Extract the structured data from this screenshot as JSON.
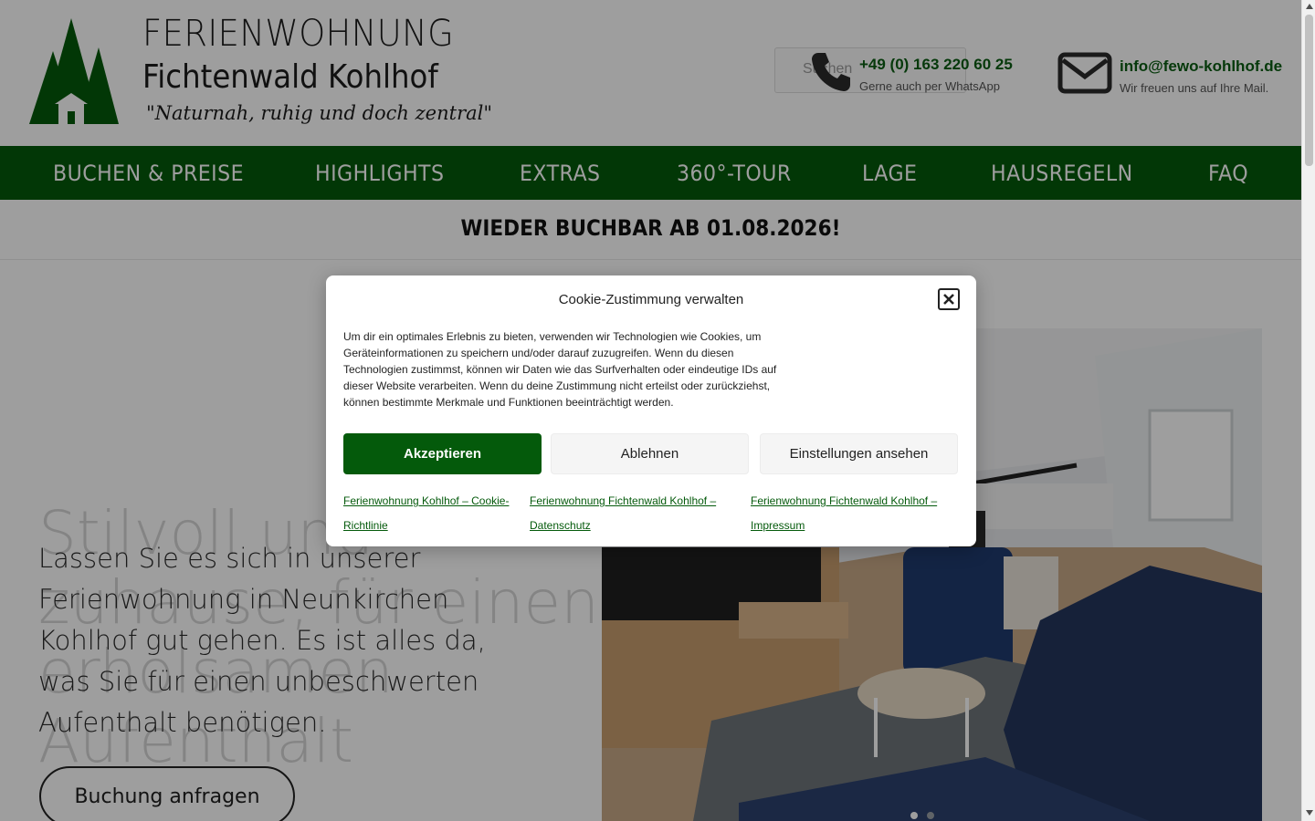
{
  "header": {
    "brand_line1": "FERIENWOHNUNG",
    "brand_line2": "Fichtenwald Kohlhof",
    "tagline": "\"Naturnah, ruhig und doch zentral\"",
    "search_placeholder": "Suchen",
    "phone": "+49 (0) 163 220 60 25",
    "phone_sub": "Gerne auch per WhatsApp",
    "email": "info@fewo-kohlhof.de",
    "email_sub": "Wir freuen uns auf Ihre Mail."
  },
  "nav": {
    "items": [
      "BUCHEN & PREISE",
      "HIGHLIGHTS",
      "EXTRAS",
      "360°-TOUR",
      "LAGE",
      "HAUSREGELN",
      "FAQ"
    ]
  },
  "banner": {
    "text": "WIEDER BUCHBAR AB 01.08.2026!"
  },
  "hero": {
    "heading": "Stilvoll und zuhause, für einen erholsamen Aufenthalt",
    "text": "Lassen Sie es sich in unserer Ferienwohnung in Neunkirchen Kohlhof gut gehen. Es ist alles da, was Sie für einen unbeschwerten Aufenthalt benötigen.",
    "button": "Buchung anfragen"
  },
  "cookie": {
    "title": "Cookie-Zustimmung verwalten",
    "body": "Um dir ein optimales Erlebnis zu bieten, verwenden wir Technologien wie Cookies, um Geräteinformationen zu speichern und/oder darauf zuzugreifen. Wenn du diesen Technologien zustimmst, können wir Daten wie das Surfverhalten oder eindeutige IDs auf dieser Website verarbeiten. Wenn du deine Zustimmung nicht erteilst oder zurückziehst, können bestimmte Merkmale und Funktionen beeinträchtigt werden.",
    "accept": "Akzeptieren",
    "deny": "Ablehnen",
    "settings": "Einstellungen ansehen",
    "links": [
      "Ferienwohnung Kohlhof – Cookie-Richtlinie",
      "Ferienwohnung Fichtenwald Kohlhof – Datenschutz",
      "Ferienwohnung Fichtenwald Kohlhof – Impressum"
    ]
  },
  "colors": {
    "brand_green": "#045a0b",
    "link_green": "#0a5d12"
  }
}
